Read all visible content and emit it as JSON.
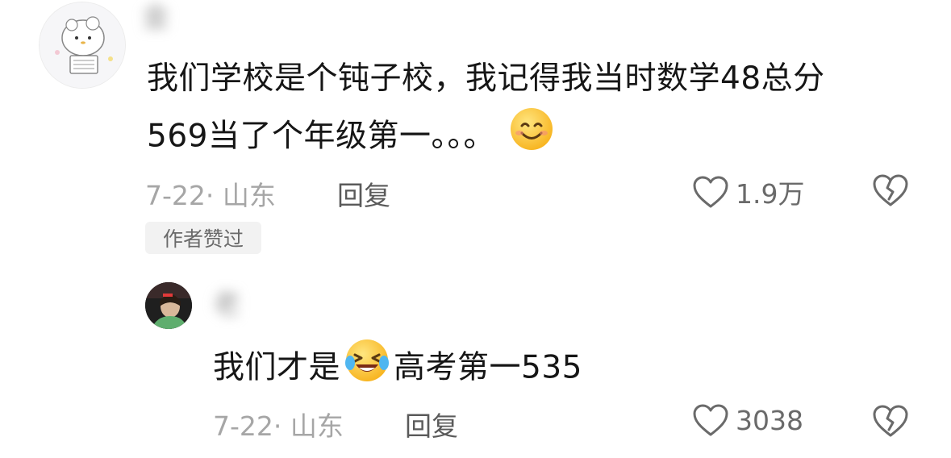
{
  "comment": {
    "username": "金",
    "text_part1": "我们学校是个钝子校，我记得我当时数学48总分",
    "text_part2": "569当了个年级第一。。。",
    "emoji": "smiling-face",
    "date_location": "7-22· 山东",
    "reply_label": "回复",
    "like_count": "1.9万",
    "author_liked_badge": "作者赞过"
  },
  "reply": {
    "username": "老",
    "text_before_emoji": "我们才是",
    "emoji": "face-with-tears-of-joy",
    "text_after_emoji": "高考第一535",
    "date_location": "7-22· 山东",
    "reply_label": "回复",
    "like_count": "3038"
  },
  "colors": {
    "text": "#161616",
    "meta": "#a6a6a6",
    "icon": "#6a6a6a",
    "badge_bg": "#f2f2f2"
  }
}
